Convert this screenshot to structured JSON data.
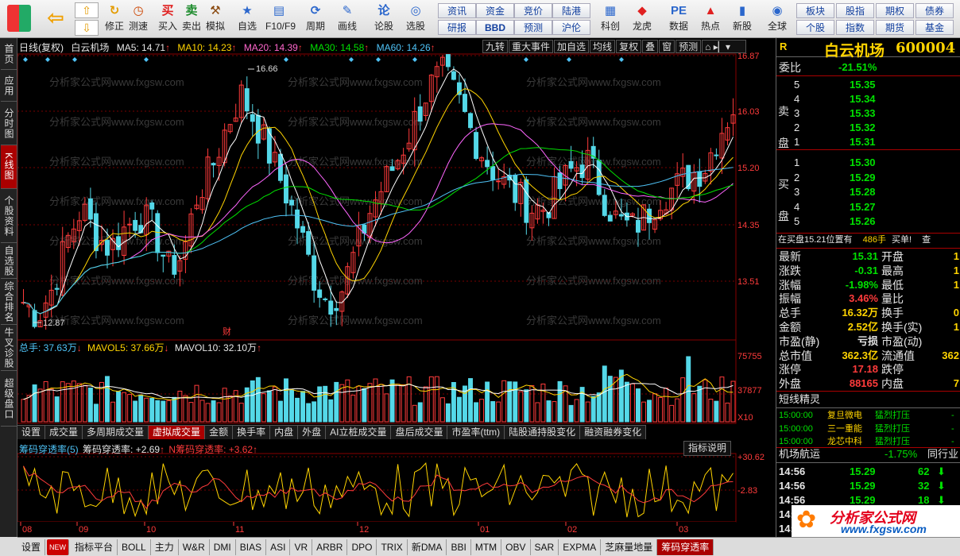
{
  "toolbar": {
    "items": [
      {
        "label": "修正",
        "icon": "refresh-icon"
      },
      {
        "label": "测速",
        "icon": "clock-icon"
      },
      {
        "label": "买入",
        "icon": "buy-icon",
        "glyph": "买"
      },
      {
        "label": "卖出",
        "icon": "sell-icon",
        "glyph": "卖"
      },
      {
        "label": "模拟",
        "icon": "hammer-icon"
      },
      {
        "label": "自选",
        "icon": "star-icon"
      },
      {
        "label": "F10/F9",
        "icon": "f10-icon"
      },
      {
        "label": "周期",
        "icon": "cycle-icon"
      },
      {
        "label": "画线",
        "icon": "pencil-icon"
      },
      {
        "label": "论股",
        "icon": "discuss-icon",
        "glyph": "论"
      },
      {
        "label": "选股",
        "icon": "select-icon"
      },
      {
        "label": "科创",
        "icon": "kechuang-icon"
      },
      {
        "label": "龙虎",
        "icon": "longhu-icon"
      },
      {
        "label": "数据",
        "icon": "data-icon",
        "glyph": "PE"
      },
      {
        "label": "热点",
        "icon": "hot-icon"
      },
      {
        "label": "新股",
        "icon": "newstock-icon"
      },
      {
        "label": "全球",
        "icon": "globe-icon"
      }
    ],
    "small": [
      "资讯",
      "资金",
      "竞价",
      "陆港",
      "研报",
      "BBD",
      "预测",
      "沪伦"
    ],
    "right_small": [
      "板块",
      "股指",
      "期权",
      "债券",
      "个股",
      "指数",
      "期货",
      "基金"
    ]
  },
  "sidebar": [
    "首页",
    "应用",
    "分时图",
    "K线图",
    "个股资料",
    "自选股",
    "综合排名",
    "牛叉诊股",
    "超级盘口"
  ],
  "chart": {
    "header": {
      "period": "日线(复权)",
      "name": "白云机场",
      "ma5": "MA5: 14.71",
      "ma10": "MA10: 14.23",
      "ma20": "MA20: 14.39",
      "ma30": "MA30: 14.58",
      "ma60": "MA60: 14.26"
    },
    "buttons": [
      "九转",
      "重大事件",
      "加自选",
      "均线",
      "复权",
      "叠",
      "窗",
      "预测"
    ],
    "price_axis": [
      "16.87",
      "16.03",
      "15.20",
      "14.35",
      "13.51"
    ],
    "max_label": "16.66",
    "min_label": "12.87",
    "event_label": "财",
    "vol_header": {
      "total": "总手: 37.63万",
      "mavol5": "MAVOL5: 37.66万",
      "mavol10": "MAVOL10: 32.10万"
    },
    "vol_axis": [
      "75755",
      "37877"
    ],
    "vol_unit": "X10",
    "tabs": [
      "设置",
      "成交量",
      "多周期成交量",
      "虚拟成交量",
      "金额",
      "换手率",
      "内盘",
      "外盘",
      "AI立桩成交量",
      "盘后成交量",
      "市盈率(ttm)",
      "陆股通持股变化",
      "融资融券变化"
    ],
    "ind_header": {
      "name": "筹码穿透率(5)",
      "v1": "筹码穿透率: +2.69",
      "v2": "N筹码穿透率: +3.62"
    },
    "ind_btn": "指标说明",
    "ind_axis": [
      "+30.62",
      "-2.83"
    ],
    "months": [
      "08",
      "09",
      "10",
      "11",
      "12",
      "01",
      "02",
      "03"
    ],
    "watermark": "分析家公式网www.fxgsw.com"
  },
  "bottom": [
    "设置",
    "NEW",
    "指标平台",
    "BOLL",
    "主力",
    "W&R",
    "DMI",
    "BIAS",
    "ASI",
    "VR",
    "ARBR",
    "DPO",
    "TRIX",
    "新DMA",
    "BBI",
    "MTM",
    "OBV",
    "SAR",
    "EXPMA",
    "芝麻量地量",
    "筹码穿透率"
  ],
  "right": {
    "title": "白云机场",
    "code": "600004",
    "badge": "R",
    "weibi_label": "委比",
    "weibi": "-21.51%",
    "sell_label": [
      "卖",
      "盘"
    ],
    "buy_label": [
      "买",
      "盘"
    ],
    "asks": [
      [
        "5",
        "15.35"
      ],
      [
        "4",
        "15.34"
      ],
      [
        "3",
        "15.33"
      ],
      [
        "2",
        "15.32"
      ],
      [
        "1",
        "15.31"
      ]
    ],
    "bids": [
      [
        "1",
        "15.30"
      ],
      [
        "2",
        "15.29"
      ],
      [
        "3",
        "15.28"
      ],
      [
        "4",
        "15.27"
      ],
      [
        "5",
        "15.26"
      ]
    ],
    "notice": "在买盘15.21位置有",
    "notice_vol": "486手",
    "notice_tag": "买单!",
    "notice_more": "查",
    "stats": [
      [
        "最新",
        "15.31",
        "开盘",
        "1"
      ],
      [
        "涨跌",
        "-0.31",
        "最高",
        "1"
      ],
      [
        "涨幅",
        "-1.98%",
        "最低",
        "1"
      ],
      [
        "振幅",
        "3.46%",
        "量比",
        ""
      ],
      [
        "总手",
        "16.32万",
        "换手",
        "0"
      ],
      [
        "金额",
        "2.52亿",
        "换手(实)",
        "1"
      ],
      [
        "市盈(静)",
        "亏损",
        "市盈(动)",
        ""
      ],
      [
        "总市值",
        "362.3亿",
        "流通值",
        "362"
      ],
      [
        "涨停",
        "17.18",
        "跌停",
        ""
      ],
      [
        "外盘",
        "88165",
        "内盘",
        "7"
      ]
    ],
    "sprite_title": "短线精灵",
    "sprites": [
      [
        "15:00:00",
        "复旦微电",
        "猛烈打压",
        "-"
      ],
      [
        "15:00:00",
        "三一重能",
        "猛烈打压",
        "-"
      ],
      [
        "15:00:00",
        "龙芯中科",
        "猛烈打压",
        "-"
      ]
    ],
    "flight_title": "机场航运",
    "flight_pct": "-1.75%",
    "flight_tag": "同行业",
    "ticks": [
      [
        "14:56",
        "15.29",
        "62"
      ],
      [
        "14:56",
        "15.29",
        "32"
      ],
      [
        "14:56",
        "15.29",
        "18"
      ],
      [
        "14:56",
        "15.29",
        ""
      ],
      [
        "14:56",
        "15.29",
        ""
      ]
    ],
    "logo_text": "分析家公式网",
    "logo_url": "www.fxgsw.com"
  },
  "colors": {
    "up": "#ff3b3b",
    "down": "#54d8e8",
    "ma5": "#ffffff",
    "ma10": "#ffd400",
    "ma20": "#ff66ff",
    "ma30": "#00e000",
    "ma60": "#4fc3f7"
  }
}
